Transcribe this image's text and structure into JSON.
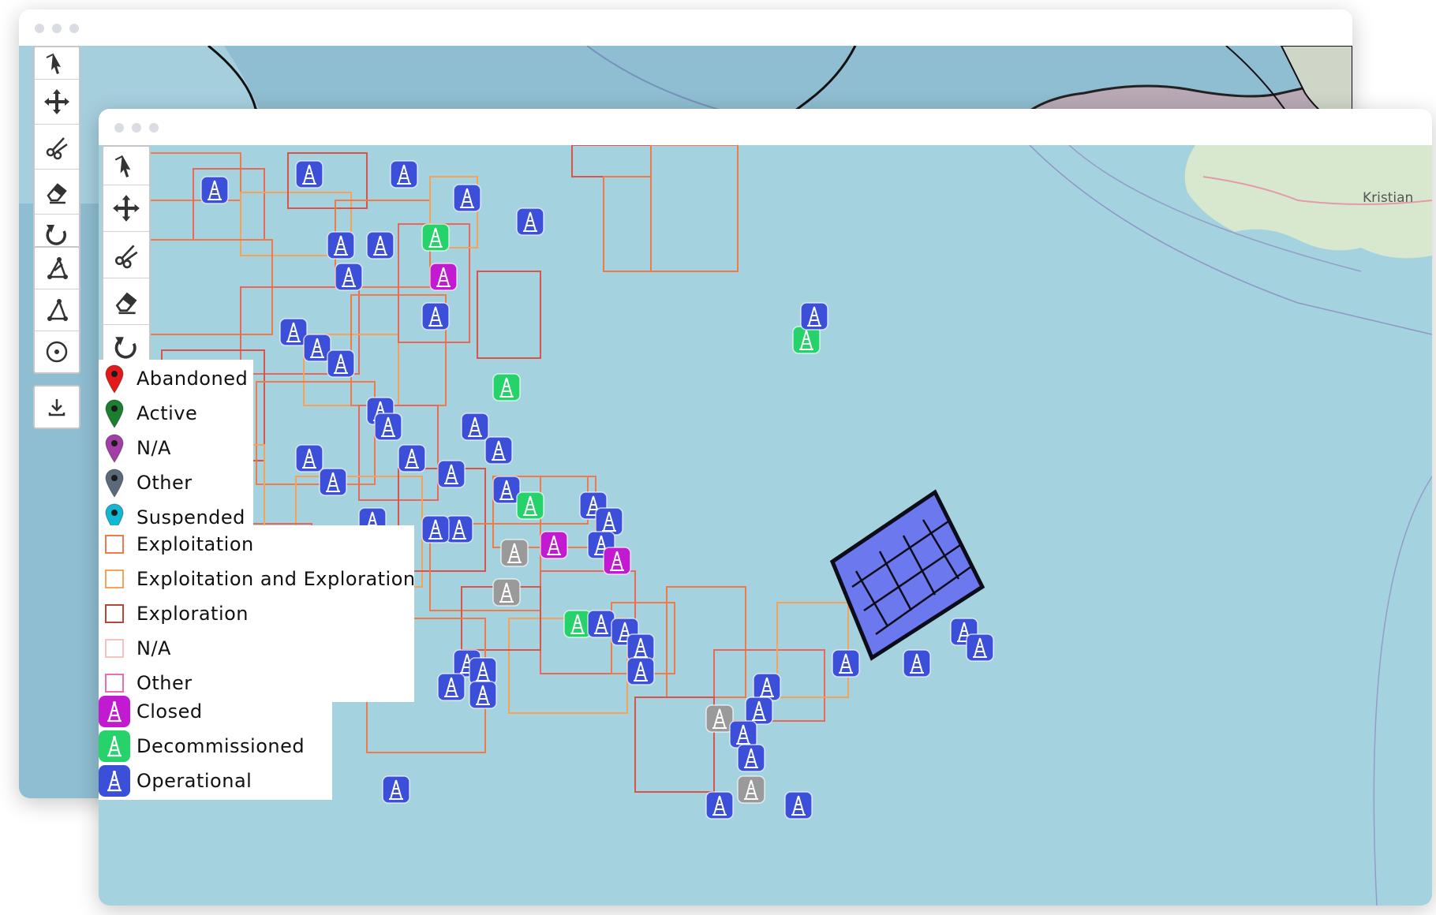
{
  "windows": {
    "back": {
      "title": ""
    },
    "front": {
      "title": ""
    }
  },
  "map": {
    "place_label": "Kristian",
    "colors": {
      "sea": "#a4d2df",
      "land": "#d8e8cf",
      "land_back": "#b9a9b6",
      "operational": "#3b4fd8",
      "decommissioned": "#26d36a",
      "closed": "#c21ad1",
      "other_rig": "#9a9a9a"
    }
  },
  "toolbar_back": {
    "tools": [
      {
        "icon": "select-pointer-icon"
      },
      {
        "icon": "move-icon"
      },
      {
        "icon": "cut-icon"
      },
      {
        "icon": "eraser-icon"
      },
      {
        "icon": "rotate-icon"
      },
      {
        "icon": "draw-polygon-icon"
      },
      {
        "icon": "draw-line-icon"
      },
      {
        "icon": "draw-circle-icon"
      },
      {
        "icon": "download-icon"
      }
    ]
  },
  "toolbar_front": {
    "tools": [
      {
        "icon": "select-pointer-icon"
      },
      {
        "icon": "move-icon"
      },
      {
        "icon": "cut-icon"
      },
      {
        "icon": "eraser-icon"
      },
      {
        "icon": "rotate-icon"
      }
    ]
  },
  "legend_well_status": {
    "items": [
      {
        "label": "Abandoned",
        "color": "#e31a1c"
      },
      {
        "label": "Active",
        "color": "#1a7f2e"
      },
      {
        "label": "N/A",
        "color": "#a23fa6"
      },
      {
        "label": "Other",
        "color": "#5a6a7a"
      },
      {
        "label": "Suspended",
        "color": "#11b8d3"
      }
    ]
  },
  "legend_license": {
    "items": [
      {
        "label": "Exploitation",
        "color": "#f07a4a"
      },
      {
        "label": "Exploitation and Exploration",
        "color": "#f5a25a"
      },
      {
        "label": "Exploration",
        "color": "#b5473a"
      },
      {
        "label": "N/A",
        "color": "#f6c2bb"
      },
      {
        "label": "Other",
        "color": "#ea6fb0"
      }
    ]
  },
  "legend_facility": {
    "items": [
      {
        "label": "Closed",
        "color": "#c21ad1"
      },
      {
        "label": "Decommissioned",
        "color": "#26d36a"
      },
      {
        "label": "Operational",
        "color": "#3b4fd8"
      }
    ]
  }
}
